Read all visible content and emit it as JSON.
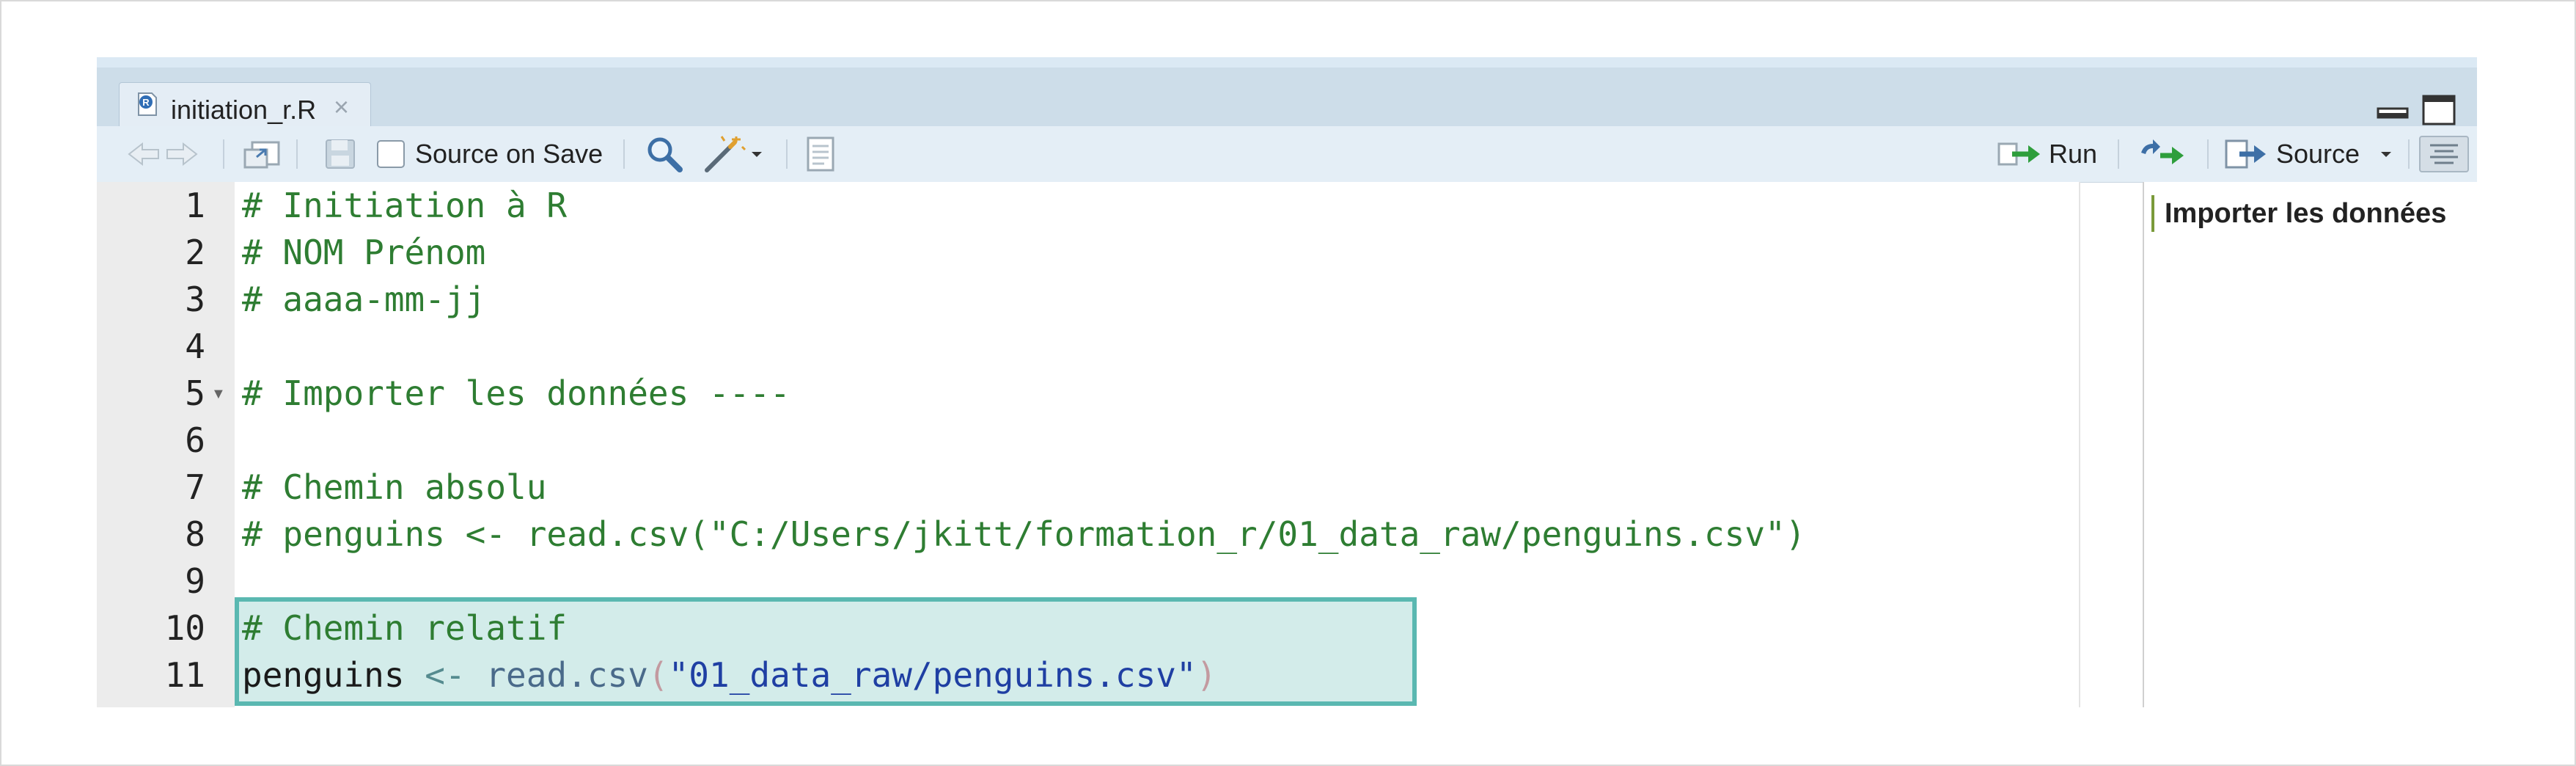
{
  "tab": {
    "title": "initiation_r.R",
    "close": "×"
  },
  "toolbar": {
    "source_on_save_label": "Source on Save",
    "source_on_save_checked": false,
    "run_label": "Run",
    "source_label": "Source"
  },
  "editor": {
    "line_numbers": [
      "1",
      "2",
      "3",
      "4",
      "5",
      "6",
      "7",
      "8",
      "9",
      "10",
      "11"
    ],
    "lines": {
      "l1": "# Initiation à R",
      "l2": "# NOM Prénom",
      "l3": "# aaaa-mm-jj",
      "l5": "# Importer les données ----",
      "l7": "# Chemin absolu",
      "l8": "# penguins <- read.csv(\"C:/Users/jkitt/formation_r/01_data_raw/penguins.csv\")",
      "l10": "# Chemin relatif",
      "l11_var": "penguins",
      "l11_op": " <- ",
      "l11_fn": "read.csv",
      "l11_open": "(",
      "l11_str": "\"01_data_raw/penguins.csv\"",
      "l11_close": ")"
    }
  },
  "outline": {
    "items": [
      "Importer les données"
    ]
  },
  "colors": {
    "comment": "#2e7d32",
    "string": "#1f3fa3",
    "highlight_border": "#5ab8b1",
    "highlight_fill": "#d3ecea"
  },
  "icons": [
    "r-file-icon",
    "back-arrow-icon",
    "forward-arrow-icon",
    "show-in-window-icon",
    "save-icon",
    "search-icon",
    "magic-wand-icon",
    "notebook-icon",
    "run-icon",
    "rerun-icon",
    "source-icon",
    "outline-toggle-icon",
    "minimize-icon",
    "maximize-icon"
  ]
}
